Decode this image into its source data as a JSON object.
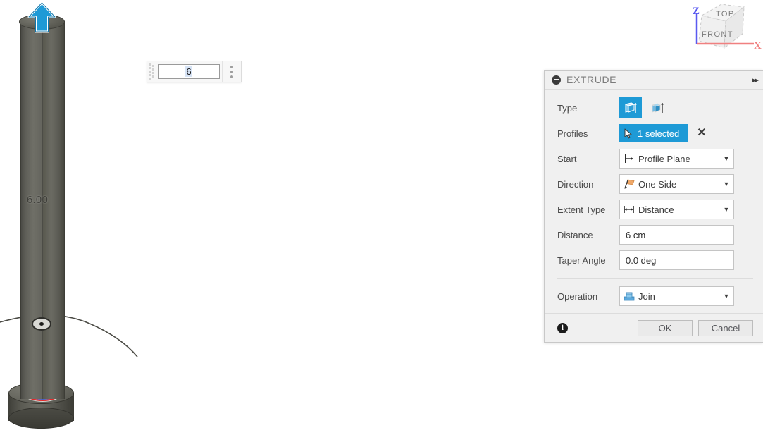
{
  "viewport": {
    "dimension_label": "6.00",
    "manipulator_icon": "up-arrow-manipulator",
    "origin_icon": "origin-point-marker",
    "profile_icon": "selected-circular-profile"
  },
  "value_widget": {
    "value": "6",
    "grip_icon": "drag-grip-icon",
    "menu_icon": "kebab-menu-icon"
  },
  "viewcube": {
    "top_face": "TOP",
    "front_face": "FRONT",
    "axis_z": "Z",
    "axis_x": "X",
    "axis_z_color": "#5a5af0",
    "axis_x_color": "#f08080"
  },
  "dialog": {
    "title": "EXTRUDE",
    "collapse_icon": "collapse-minus-icon",
    "expand_icon": "double-chevron-right-icon",
    "accent_color": "#1e9ad6",
    "rows": {
      "type": {
        "label": "Type",
        "options": [
          {
            "icon": "extrude-profile-icon",
            "selected": true
          },
          {
            "icon": "extrude-thin-icon",
            "selected": false
          }
        ]
      },
      "profiles": {
        "label": "Profiles",
        "selection_text": "1 selected",
        "select_icon": "cursor-arrow-icon",
        "clear_icon": "clear-x-icon"
      },
      "start": {
        "label": "Start",
        "value": "Profile Plane",
        "icon": "profile-plane-icon"
      },
      "direction": {
        "label": "Direction",
        "value": "One Side",
        "icon": "one-side-direction-icon"
      },
      "extent_type": {
        "label": "Extent Type",
        "value": "Distance",
        "icon": "distance-extent-icon"
      },
      "distance": {
        "label": "Distance",
        "value": "6 cm"
      },
      "taper_angle": {
        "label": "Taper Angle",
        "value": "0.0 deg"
      },
      "operation": {
        "label": "Operation",
        "value": "Join",
        "icon": "join-operation-icon"
      }
    },
    "footer": {
      "info_icon": "info-icon",
      "info_glyph": "i",
      "ok_label": "OK",
      "cancel_label": "Cancel"
    }
  }
}
